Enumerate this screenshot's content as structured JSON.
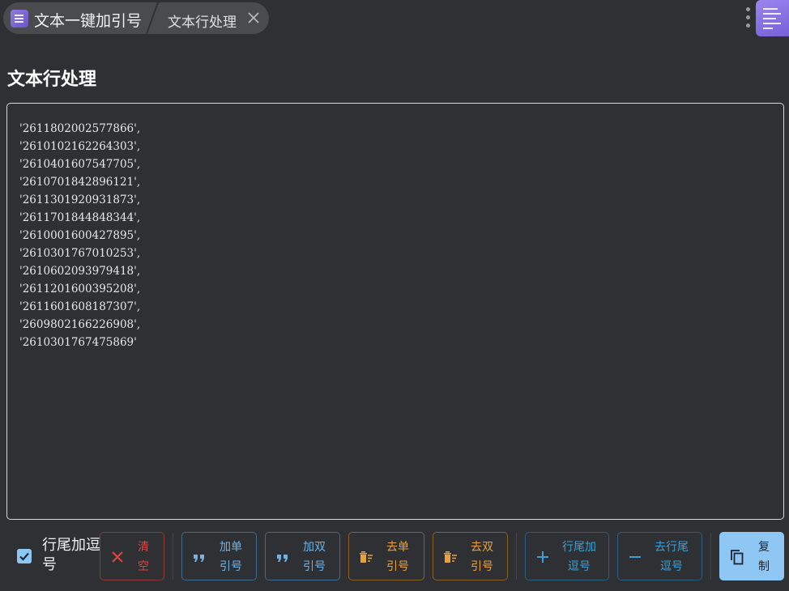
{
  "header": {
    "app_title": "文本一键加引号",
    "page_tab": "文本行处理"
  },
  "page": {
    "title": "文本行处理"
  },
  "editor": {
    "lines": [
      "'2611802002577866',",
      "'2610102162264303',",
      "'2610401607547705',",
      "'2610701842896121',",
      "'2611301920931873',",
      "'2611701844848344',",
      "'2610001600427895',",
      "'2610301767010253',",
      "'2610602093979418',",
      "'2611201600395208',",
      "'2611601608187307',",
      "'2609802166226908',",
      "'2610301767475869'"
    ]
  },
  "toolbar": {
    "trailing_comma_label": "行尾加逗号",
    "trailing_comma_checked": true,
    "buttons": {
      "clear": {
        "line1": "清",
        "line2": "空",
        "color": "#e0453e"
      },
      "add_single": {
        "line1": "加单",
        "line2": "引号",
        "color": "#6fb3e8"
      },
      "add_double": {
        "line1": "加双",
        "line2": "引号",
        "color": "#6fb3e8"
      },
      "remove_single": {
        "line1": "去单",
        "line2": "引号",
        "color": "#e9a23b"
      },
      "remove_double": {
        "line1": "去双",
        "line2": "引号",
        "color": "#e9a23b"
      },
      "add_trailing_comma": {
        "line1": "行尾加",
        "line2": "逗号",
        "color": "#3b9fd6"
      },
      "remove_trailing_comma": {
        "line1": "去行尾",
        "line2": "逗号",
        "color": "#3b9fd6"
      },
      "copy": {
        "line1": "复",
        "line2": "制",
        "color": "#8ec6f4"
      }
    }
  },
  "icons": {
    "app": "notebook-icon",
    "tab_close": "close-icon",
    "menu": "more-vertical-icon",
    "notes": "notes-icon"
  }
}
